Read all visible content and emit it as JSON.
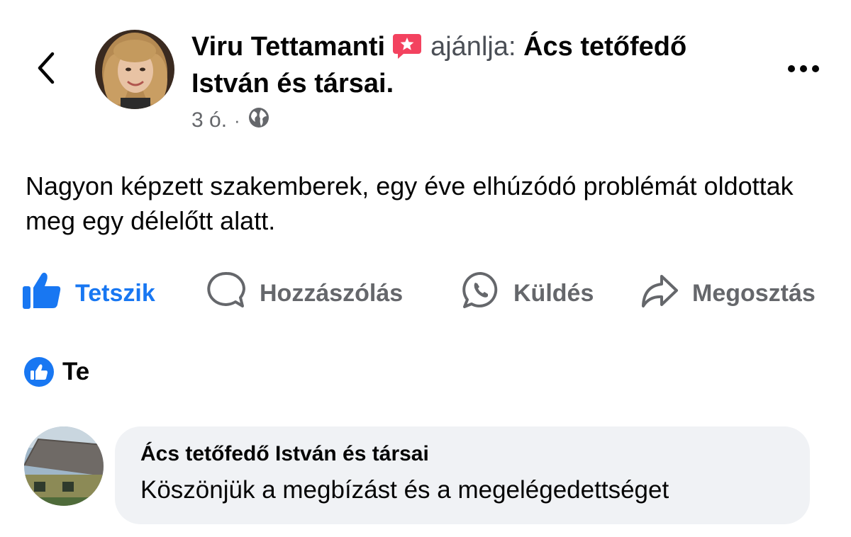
{
  "post": {
    "author_name": "Viru Tettamanti",
    "verb": "ajánlja:",
    "page_name": "Ács tetőfedő István és társai.",
    "time": "3 ó.",
    "separator": "·",
    "privacy_icon": "globe-icon",
    "text": "Nagyon képzett szakemberek, egy éve elhúzódó problémát oldottak meg egy délelőtt alatt."
  },
  "actions": {
    "like_label": "Tetszik",
    "comment_label": "Hozzászólás",
    "send_label": "Küldés",
    "share_label": "Megosztás"
  },
  "reactions": {
    "who": "Te",
    "icon": "like-icon"
  },
  "comment": {
    "author": "Ács tetőfedő István és társai",
    "text": "Köszönjük a megbízást és a megelégedettséget"
  },
  "colors": {
    "accent": "#1877f2",
    "recommend_badge": "#f3425f",
    "secondary_text": "#65676b",
    "bubble_bg": "#f0f2f5"
  }
}
